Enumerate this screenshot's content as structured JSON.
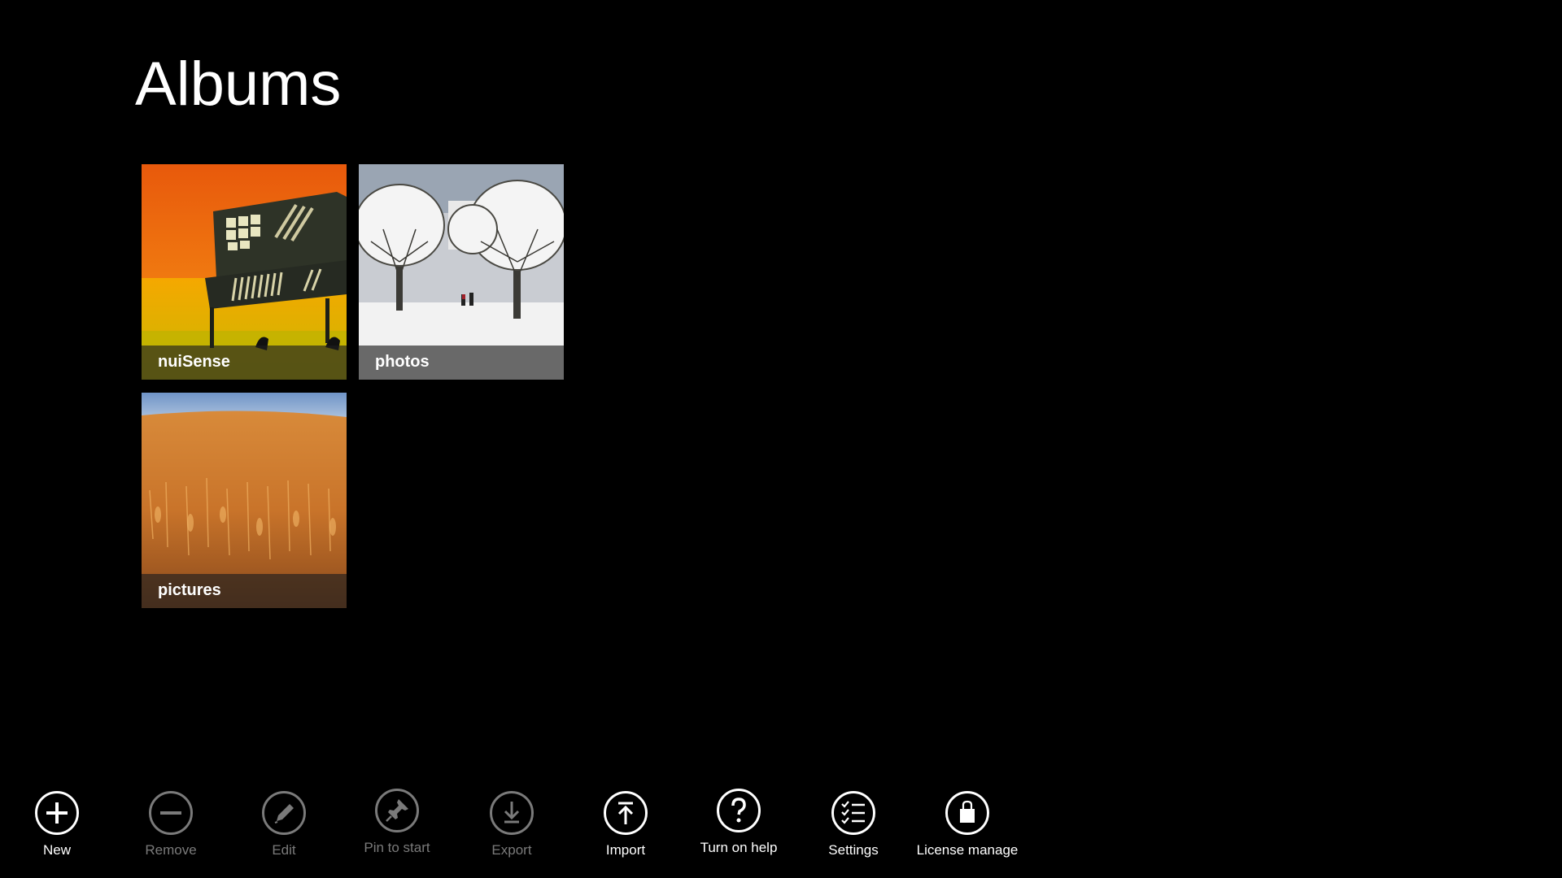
{
  "page": {
    "title": "Albums"
  },
  "albums": [
    {
      "label": "nuiSense",
      "thumbnail": "orange-wall-bench-photo"
    },
    {
      "label": "photos",
      "thumbnail": "snowy-trees-photo"
    },
    {
      "label": "pictures",
      "thumbnail": "wheat-field-photo"
    }
  ],
  "appbar": {
    "commands": [
      {
        "label": "New",
        "icon": "plus-icon",
        "enabled": true
      },
      {
        "label": "Remove",
        "icon": "minus-icon",
        "enabled": false
      },
      {
        "label": "Edit",
        "icon": "pencil-icon",
        "enabled": false
      },
      {
        "label": "Pin to start",
        "icon": "pin-icon",
        "enabled": false
      },
      {
        "label": "Export",
        "icon": "download-icon",
        "enabled": false
      },
      {
        "label": "Import",
        "icon": "upload-icon",
        "enabled": true
      },
      {
        "label": "Turn on help",
        "icon": "question-icon",
        "enabled": true
      },
      {
        "label": "Settings",
        "icon": "checklist-icon",
        "enabled": true
      },
      {
        "label": "License manage",
        "icon": "shopping-bag-icon",
        "enabled": true
      }
    ]
  },
  "colors": {
    "background": "#000000",
    "text": "#ffffff",
    "disabled": "#7a7a7a"
  }
}
